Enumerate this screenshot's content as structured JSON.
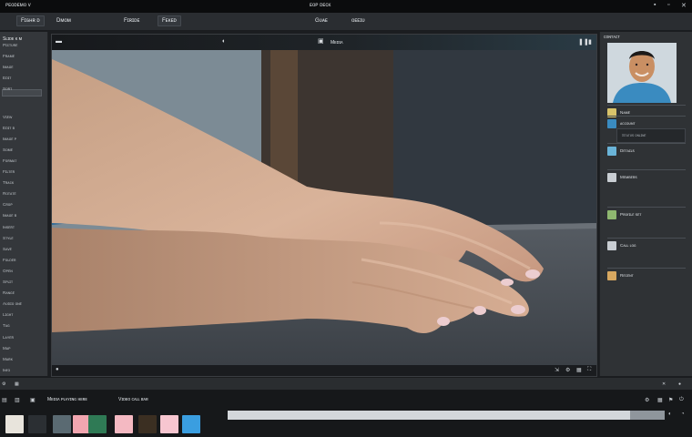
{
  "window": {
    "app_label": "ᴘᴇᴏᴅᴇᴍᴏ ᴠ",
    "title": "ᴇᴏᴘ ᴅᴇᴄᴋ",
    "controls": [
      "ʙ",
      "ᴅ",
      "ᴅ"
    ]
  },
  "menu": {
    "items": [
      "Fɪɢʜʀ ᴅ",
      "Dᴍᴏᴍ",
      "Fɪʀɪᴅᴇ",
      "Fᴇᴋᴇᴅ"
    ],
    "center": [
      "Gᴜᴀᴇ",
      "ᴏᴇᴇɪᴜ"
    ]
  },
  "sidebar": {
    "header": "Sʟɪᴅᴇ ᴋ ᴍ",
    "items": [
      "Pɪᴄᴛᴜʀᴇ",
      "Fʀᴀᴍᴇ",
      "Iᴍᴀɢᴇ",
      "Eᴅɪᴛ",
      "Sᴏʀᴛ",
      "Vɪᴇᴡ",
      "Eᴅɪᴛ ʙ",
      "Iᴍᴀɢᴇ ᴘ",
      "Sᴏᴍᴇ",
      "Fᴏʀᴍᴀᴛ",
      "Fɪʟᴛᴇʀ",
      "Tʀᴀᴄᴋ",
      "Rᴏᴛᴀᴛᴇ",
      "Cʀᴏᴘ",
      "Iᴍᴀɢᴇ ʙ",
      "Iɴsᴇʀᴛ",
      "Sᴛʏʟᴇ",
      "Sᴀᴠᴇ",
      "Fᴏʟᴅᴇʀ",
      "Oᴘᴇɴ",
      "Sᴘʟɪᴛ",
      "Rᴀɴɢᴇ",
      "Aᴜᴅɪᴏ ᴏɴᴇ",
      "Lɪɢʜᴛ",
      "Tᴀɢ",
      "Lᴀʏᴇʀ",
      "Mᴀᴘ",
      "Mᴀʀᴋ",
      "Iɴғᴏ",
      "Lᴏᴏᴋ"
    ]
  },
  "viewer": {
    "header_label": "Mᴇᴅɪᴀ",
    "header_icons": [
      "camera-icon",
      "pause-icon",
      "window-icon"
    ],
    "footer_icons": [
      "dot-icon",
      "resize-icon",
      "settings-icon",
      "fullscreen-icon"
    ]
  },
  "right_panel": {
    "header": "ᴄᴏɴᴛᴀᴄᴛ",
    "rows": [
      {
        "label": "Nᴀᴍᴇ",
        "sub": ""
      },
      {
        "label": "ᴀᴄᴄᴏᴜɴᴛ",
        "sub": "Sᴛᴀᴛᴜs ᴏɴʟɪɴᴇ"
      },
      {
        "label": "Dᴇᴛᴀɪʟs",
        "sub": ""
      },
      {
        "label": "Mᴇᴍʙᴇʀs",
        "sub": ""
      },
      {
        "label": "Pʀᴏғɪʟᴇ sᴇᴛ",
        "sub": ""
      },
      {
        "label": "Cᴀʟʟ ʟᴏɢ",
        "sub": ""
      },
      {
        "label": "Rᴇᴄᴇɴᴛ",
        "sub": ""
      }
    ]
  },
  "statusbar": {
    "left_icons": [
      "gear-icon",
      "grid-icon"
    ],
    "text_1": "Mᴇᴅɪᴀ ᴘʟᴀʏɪɴɢ ʜᴇʀᴇ",
    "text_2": "Vɪᴅᴇᴏ ᴄᴀʟʟ ʙᴀʀ"
  },
  "taskbar": {
    "progress": 0.92,
    "tile_colors": [
      "#e8e4dc",
      "#2b2f33",
      "#5a6a72",
      "#f2a6b0",
      "#2f7a55",
      "#f4b9c2",
      "#3b2f22",
      "#f7c6d0",
      "#3a9ee0"
    ]
  }
}
